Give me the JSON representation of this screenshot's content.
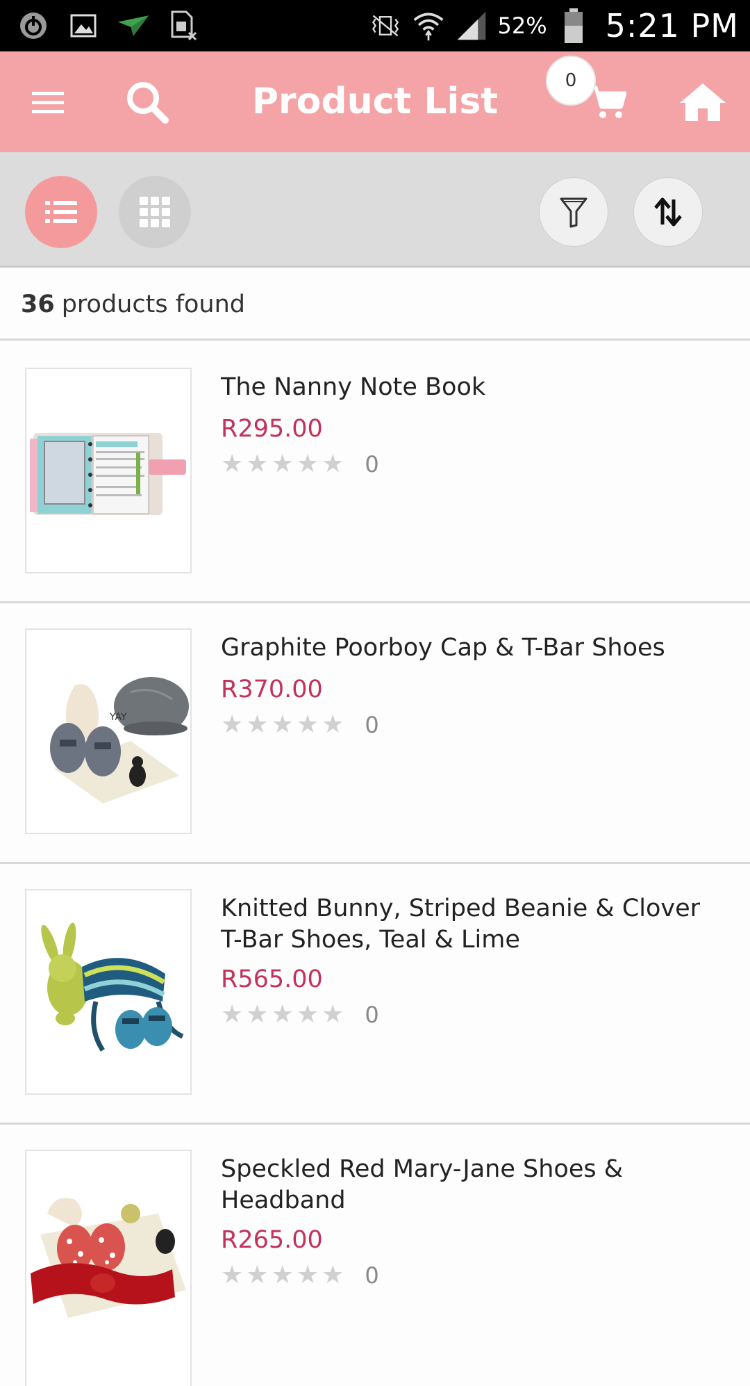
{
  "status_bar": {
    "battery_percent": "52%",
    "time": "5:21 PM",
    "icons": [
      "power-icon",
      "image-icon",
      "send-icon",
      "sim-error-icon",
      "vibrate-icon",
      "wifi-icon",
      "signal-icon",
      "battery-icon"
    ]
  },
  "app_bar": {
    "title": "Product List",
    "cart_count": "0",
    "icons": [
      "menu-icon",
      "search-icon",
      "cart-icon",
      "home-icon"
    ],
    "background_color": "#f4a4a6"
  },
  "toolbar": {
    "icons": [
      "list-view-icon",
      "grid-view-icon",
      "filter-icon",
      "sort-icon"
    ],
    "active_view": "list"
  },
  "results": {
    "count": "36",
    "label": "products found"
  },
  "products": [
    {
      "name": "The Nanny Note Book",
      "price": "R295.00",
      "rating_count": "0",
      "rating": 0
    },
    {
      "name": "Graphite Poorboy Cap & T-Bar Shoes",
      "price": "R370.00",
      "rating_count": "0",
      "rating": 0
    },
    {
      "name": "Knitted Bunny, Striped Beanie & Clover T-Bar Shoes, Teal & Lime",
      "price": "R565.00",
      "rating_count": "0",
      "rating": 0
    },
    {
      "name": "Speckled Red Mary-Jane Shoes & Headband",
      "price": "R265.00",
      "rating_count": "0",
      "rating": 0
    }
  ],
  "colors": {
    "accent": "#f4a4a6",
    "price": "#c2325a"
  }
}
